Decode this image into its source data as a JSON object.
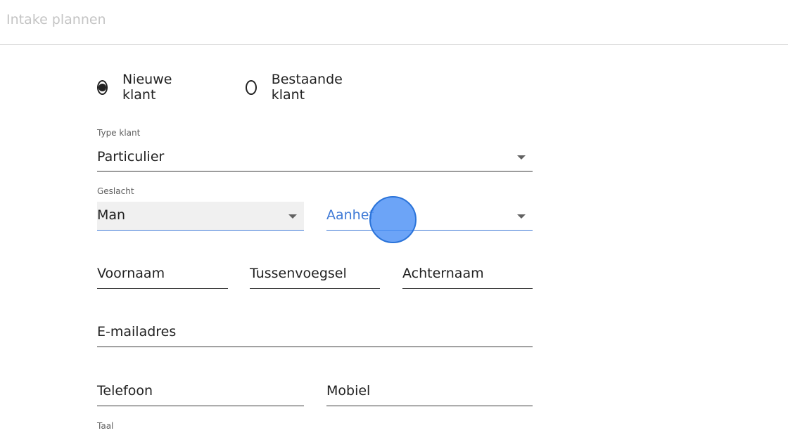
{
  "header": {
    "title": "Intake plannen"
  },
  "customer_mode": {
    "options": [
      {
        "label": "Nieuwe klant",
        "selected": true
      },
      {
        "label": "Bestaande klant",
        "selected": false
      }
    ]
  },
  "form": {
    "type_klant": {
      "label": "Type klant",
      "value": "Particulier"
    },
    "geslacht": {
      "label": "Geslacht",
      "value": "Man"
    },
    "aanhef": {
      "placeholder": "Aanhef"
    },
    "voornaam": {
      "placeholder": "Voornaam"
    },
    "tussenvoegsel": {
      "placeholder": "Tussenvoegsel"
    },
    "achternaam": {
      "placeholder": "Achternaam"
    },
    "email": {
      "placeholder": "E-mailadres"
    },
    "telefoon": {
      "placeholder": "Telefoon"
    },
    "mobiel": {
      "placeholder": "Mobiel"
    },
    "taal": {
      "label": "Taal"
    }
  },
  "colors": {
    "focus": "#3f7ad6",
    "cursor_highlight": "#428bf5",
    "header_title": "#c4c4c4"
  }
}
